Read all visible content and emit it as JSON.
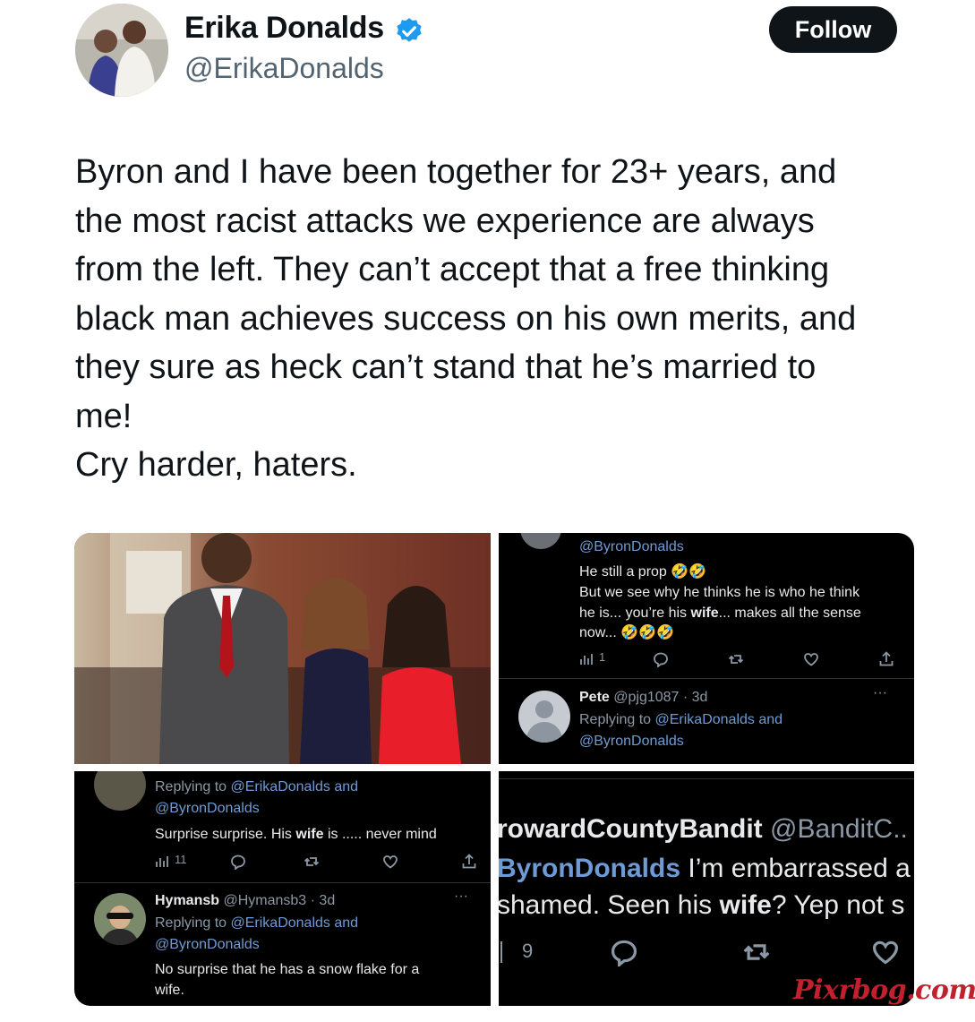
{
  "profile": {
    "name": "Erika Donalds",
    "handle": "@ErikaDonalds",
    "follow_label": "Follow"
  },
  "tweet": {
    "text": "Byron and I have been together for 23+ years, and\nthe most racist attacks we experience are always\nfrom the left. They can’t accept that a free thinking\nblack man achieves success on his own merits, and\nthey sure as heck can’t stand that he’s married to\nme!\nCry harder, haters."
  },
  "panel2": {
    "mention": "@ByronDonalds",
    "line1": "He still a prop",
    "line2": "But we see why he thinks he is who he think",
    "line3_a": "he is... you’re his ",
    "line3_b": "wife",
    "line3_c": "... makes all the sense",
    "line4": "now...",
    "views": "1",
    "reply_name": "Pete",
    "reply_handle": "@pjg1087 · 3d",
    "replying_to": "Replying to ",
    "replying_1": "@ErikaDonalds and",
    "replying_2": "@ByronDonalds"
  },
  "panel3": {
    "replying_to": "Replying to ",
    "replying_1": "@ErikaDonalds and",
    "replying_2": "@ByronDonalds",
    "text_a": "Surprise surprise. His ",
    "text_b": "wife",
    "text_c": " is ..... never mind",
    "views": "11",
    "reply_name": "Hymansb",
    "reply_handle": "@Hymansb3 · 3d",
    "reply_replying_1": "@ErikaDonalds and",
    "reply_replying_2": "@ByronDonalds",
    "reply_text_1": "No surprise that he has a snow flake for a",
    "reply_text_2": "wife."
  },
  "panel4": {
    "name": "rowardCountyBandit",
    "handle": "@BanditC..",
    "mention": "ByronDonalds",
    "text1": " I’m embarrassed a",
    "text2_a": "shamed. Seen his ",
    "text2_b": "wife",
    "text2_c": "? Yep not s",
    "views": "9"
  },
  "watermark": "Pixrbog.com",
  "colors": {
    "follow_bg": "#0f1419",
    "verified": "#1d9bf0",
    "link_dark": "#6e9bd6",
    "watermark": "#c0212d"
  }
}
